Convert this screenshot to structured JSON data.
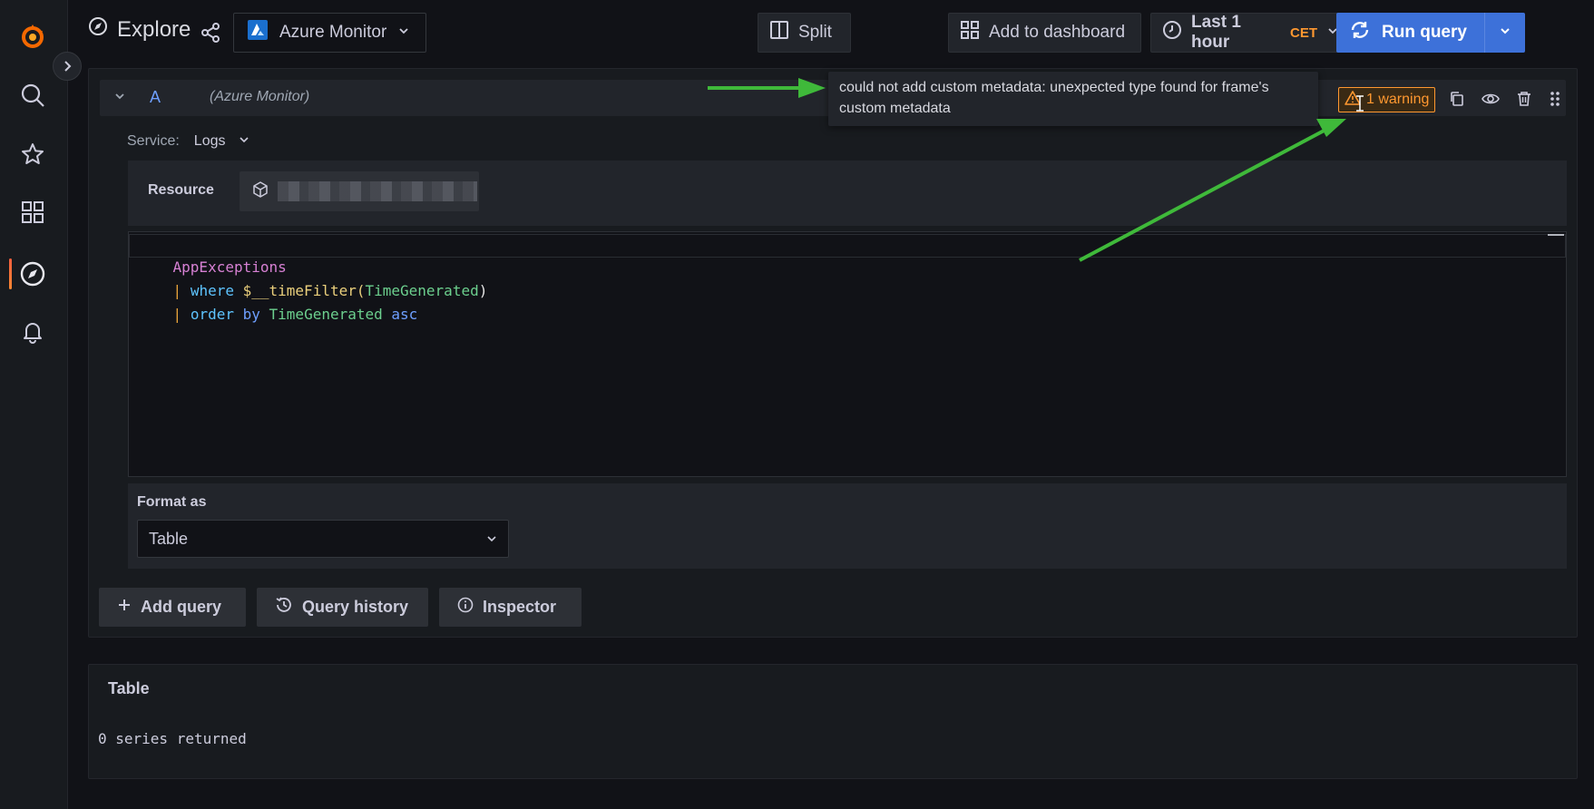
{
  "header": {
    "title": "Explore",
    "datasource": "Azure Monitor",
    "split_label": "Split",
    "add_dashboard_label": "Add to dashboard",
    "time_range": "Last 1 hour",
    "timezone": "CET",
    "run_query_label": "Run query"
  },
  "sidebar": {
    "items": [
      {
        "icon": "grafana-logo"
      },
      {
        "icon": "search-icon"
      },
      {
        "icon": "star-icon"
      },
      {
        "icon": "dashboards-icon"
      },
      {
        "icon": "explore-icon",
        "active": true
      },
      {
        "icon": "bell-icon"
      }
    ]
  },
  "query": {
    "ref_id": "A",
    "datasource_label": "(Azure Monitor)",
    "warning_label": "1 warning",
    "tooltip": "could not add custom metadata: unexpected type found for frame's custom metadata",
    "service_label": "Service:",
    "service_value": "Logs",
    "resource_label": "Resource",
    "code": {
      "table": "AppExceptions",
      "pipe": "|",
      "where": "where",
      "fn": "$__timeFilter(",
      "arg": "TimeGenerated",
      "close": ")",
      "order": "order",
      "by": "by",
      "order_field": "TimeGenerated",
      "asc": "asc"
    },
    "format_label": "Format as",
    "format_value": "Table"
  },
  "actions": {
    "add_query": "Add query",
    "query_history": "Query history",
    "inspector": "Inspector"
  },
  "results": {
    "title": "Table",
    "message": "0 series returned"
  },
  "colors": {
    "accent": "#3d71d9",
    "warning": "#ff9830",
    "annotation_arrow": "#3fb93a"
  }
}
